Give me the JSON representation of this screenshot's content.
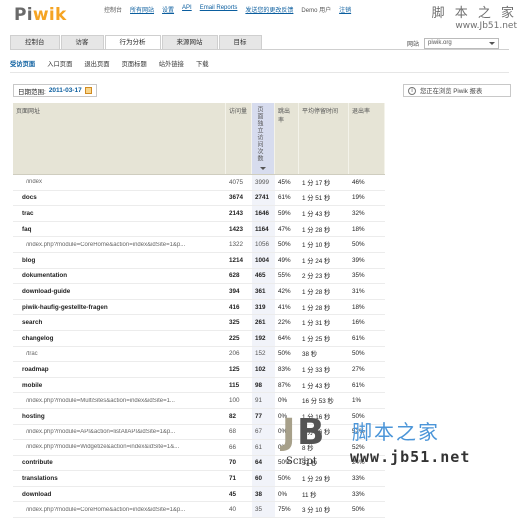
{
  "header": {
    "logo_part1": "Pi",
    "logo_part2": "wik",
    "nav_items": [
      "控制台",
      "所有网站",
      "设置",
      "API",
      "Email Reports",
      "发送您的更改反馈",
      "注销",
      "退出"
    ],
    "user": "Demo 用户"
  },
  "watermark_top": {
    "name": "脚 本 之 家",
    "url": "www.Jb51.net"
  },
  "tabs": [
    {
      "label": "控制台",
      "active": false
    },
    {
      "label": "访客",
      "active": false
    },
    {
      "label": "行为分析",
      "active": true
    },
    {
      "label": "来源网站",
      "active": false
    },
    {
      "label": "目标",
      "active": false
    }
  ],
  "site_selector": {
    "label": "网站",
    "value": "piwik.org"
  },
  "subnav": [
    {
      "label": "受访页面",
      "selected": true
    },
    {
      "label": "入口页面",
      "selected": false
    },
    {
      "label": "退出页面",
      "selected": false
    },
    {
      "label": "页面标题",
      "selected": false
    },
    {
      "label": "站外链接",
      "selected": false
    },
    {
      "label": "下载",
      "selected": false
    }
  ],
  "date": {
    "label": "日期范围:",
    "value": "2011-03-17"
  },
  "controls": {
    "label": "您正在浏览 Piwik 报表"
  },
  "table": {
    "headers": [
      "页面网址",
      "访问量",
      "页面独立访问次数",
      "跳出率",
      "平均停留时间",
      "退出率"
    ],
    "rows": [
      {
        "url": "/index",
        "sub": true,
        "hits": "4075",
        "unique": "3999",
        "bounce": "45%",
        "time": "1 分 17 秒",
        "exit": "46%"
      },
      {
        "url": "docs",
        "sub": false,
        "hits": "3674",
        "unique": "2741",
        "bounce": "61%",
        "time": "1 分 51 秒",
        "exit": "19%"
      },
      {
        "url": "trac",
        "sub": false,
        "hits": "2143",
        "unique": "1646",
        "bounce": "59%",
        "time": "1 分 43 秒",
        "exit": "32%"
      },
      {
        "url": "faq",
        "sub": false,
        "hits": "1423",
        "unique": "1164",
        "bounce": "47%",
        "time": "1 分 28 秒",
        "exit": "18%"
      },
      {
        "url": "/index.php?module=CoreHome&action=index&idSite=1&p...",
        "sub": true,
        "hits": "1322",
        "unique": "1056",
        "bounce": "50%",
        "time": "1 分 10 秒",
        "exit": "50%"
      },
      {
        "url": "blog",
        "sub": false,
        "hits": "1214",
        "unique": "1004",
        "bounce": "49%",
        "time": "1 分 24 秒",
        "exit": "39%"
      },
      {
        "url": "dokumentation",
        "sub": false,
        "hits": "628",
        "unique": "465",
        "bounce": "55%",
        "time": "2 分 23 秒",
        "exit": "35%"
      },
      {
        "url": "download-guide",
        "sub": false,
        "hits": "394",
        "unique": "361",
        "bounce": "42%",
        "time": "1 分 28 秒",
        "exit": "31%"
      },
      {
        "url": "piwik-haufig-gestellte-fragen",
        "sub": false,
        "hits": "416",
        "unique": "319",
        "bounce": "41%",
        "time": "1 分 28 秒",
        "exit": "18%"
      },
      {
        "url": "search",
        "sub": false,
        "hits": "325",
        "unique": "261",
        "bounce": "22%",
        "time": "1 分 31 秒",
        "exit": "16%"
      },
      {
        "url": "changelog",
        "sub": false,
        "hits": "225",
        "unique": "192",
        "bounce": "64%",
        "time": "1 分 25 秒",
        "exit": "61%"
      },
      {
        "url": "/trac",
        "sub": true,
        "hits": "206",
        "unique": "152",
        "bounce": "50%",
        "time": "38 秒",
        "exit": "50%"
      },
      {
        "url": "roadmap",
        "sub": false,
        "hits": "125",
        "unique": "102",
        "bounce": "83%",
        "time": "1 分 33 秒",
        "exit": "27%"
      },
      {
        "url": "mobile",
        "sub": false,
        "hits": "115",
        "unique": "98",
        "bounce": "87%",
        "time": "1 分 43 秒",
        "exit": "61%"
      },
      {
        "url": "/index.php?module=MultiSites&action=index&idSite=1...",
        "sub": true,
        "hits": "100",
        "unique": "91",
        "bounce": "0%",
        "time": "16 分 53 秒",
        "exit": "1%"
      },
      {
        "url": "hosting",
        "sub": false,
        "hits": "82",
        "unique": "77",
        "bounce": "0%",
        "time": "1 分 16 秒",
        "exit": "50%"
      },
      {
        "url": "/index.php?module=API&action=listAllAPI&idSite=1&p...",
        "sub": true,
        "hits": "68",
        "unique": "67",
        "bounce": "0%",
        "time": "3 分 26 秒",
        "exit": "52%"
      },
      {
        "url": "/index.php?module=Widgetize&action=index&idSite=1&...",
        "sub": true,
        "hits": "66",
        "unique": "61",
        "bounce": "0%",
        "time": "8 秒",
        "exit": "52%"
      },
      {
        "url": "contribute",
        "sub": false,
        "hits": "70",
        "unique": "64",
        "bounce": "50%",
        "time": "57 秒",
        "exit": "24%"
      },
      {
        "url": "translations",
        "sub": false,
        "hits": "71",
        "unique": "60",
        "bounce": "50%",
        "time": "1 分 29 秒",
        "exit": "33%"
      },
      {
        "url": "download",
        "sub": false,
        "hits": "45",
        "unique": "38",
        "bounce": "0%",
        "time": "11 秒",
        "exit": "33%"
      },
      {
        "url": "/index.php?module=CoreHome&action=index&idSite=1&p...",
        "sub": true,
        "hits": "40",
        "unique": "35",
        "bounce": "75%",
        "time": "3 分 10 秒",
        "exit": "50%"
      }
    ]
  },
  "watermark_bottom": {
    "j": "J",
    "b": "B",
    "script": "Script",
    "name": "脚本之家",
    "url": "www.jb51.net"
  }
}
